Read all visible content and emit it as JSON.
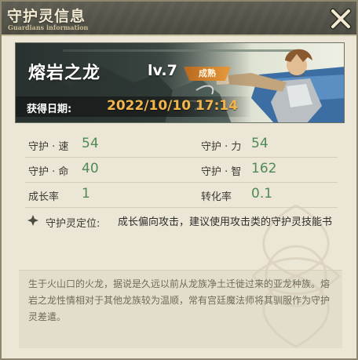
{
  "header": {
    "title": "守护灵信息",
    "subtitle": "Guardians information",
    "close_icon": "close-x-icon"
  },
  "colors": {
    "header_bg": "#4a4a41",
    "panel_bg": "#ece6d6",
    "stat_value": "#4e8a57",
    "date_value": "#f4b54a",
    "badge": "#d9862c"
  },
  "banner": {
    "name": "熔岩之龙",
    "level": "lv.7",
    "stage": "成熟",
    "date_label": "获得日期:",
    "date_value": "2022/10/10 17:14"
  },
  "stats": {
    "speed_label": "守护 · 速",
    "speed_value": "54",
    "power_label": "守护 · 力",
    "power_value": "54",
    "life_label": "守护 · 命",
    "life_value": "40",
    "wisdom_label": "守护 · 智",
    "wisdom_value": "162",
    "growth_label": "成长率",
    "growth_value": "1",
    "conversion_label": "转化率",
    "conversion_value": "0.1"
  },
  "positioning": {
    "icon": "diamond-icon",
    "label": "守护灵定位:",
    "text": "成长偏向攻击，建议使用攻击类的守护灵技能书"
  },
  "description": "生于火山口的火龙，据说是久远以前从龙族净土迁徙过来的亚龙种族。熔岩之龙性情相对于其他龙族较为温顺，常有宫廷魔法师将其驯服作为守护灵差遣。"
}
